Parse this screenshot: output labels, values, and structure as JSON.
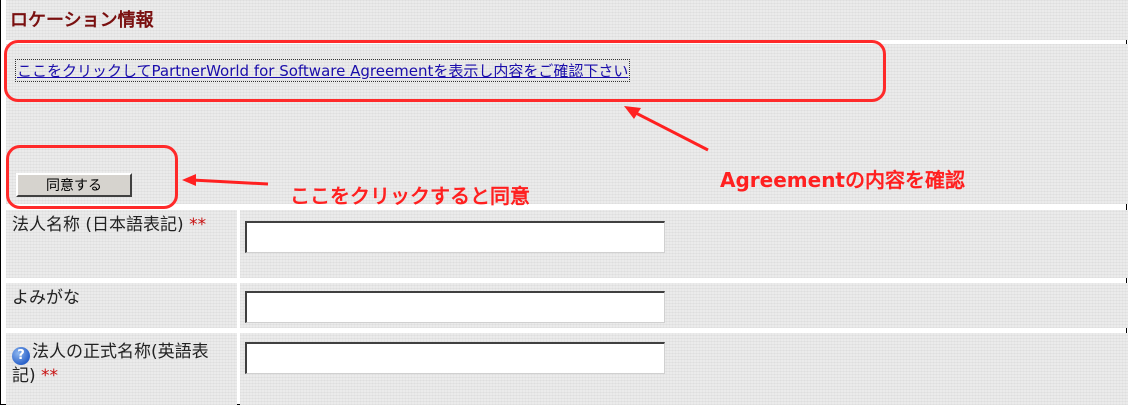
{
  "section": {
    "title": "ロケーション情報"
  },
  "agreement": {
    "link_text": "ここをクリックしてPartnerWorld for Software Agreementを表示し内容をご確認下さい",
    "agree_button_label": "同意する"
  },
  "annotations": {
    "button_note": "ここをクリックすると同意",
    "link_note": "Agreementの内容を確認",
    "color": "#ff2020"
  },
  "form": {
    "fields": [
      {
        "label": "法人名称 (日本語表記)",
        "required_mark": "**",
        "value": "",
        "has_help_icon": false
      },
      {
        "label": "よみがな",
        "required_mark": "",
        "value": "",
        "has_help_icon": false
      },
      {
        "label": "法人の正式名称(英語表記)",
        "required_mark": "**",
        "value": "",
        "has_help_icon": true
      }
    ]
  },
  "icons": {
    "help": "help-question-icon"
  }
}
